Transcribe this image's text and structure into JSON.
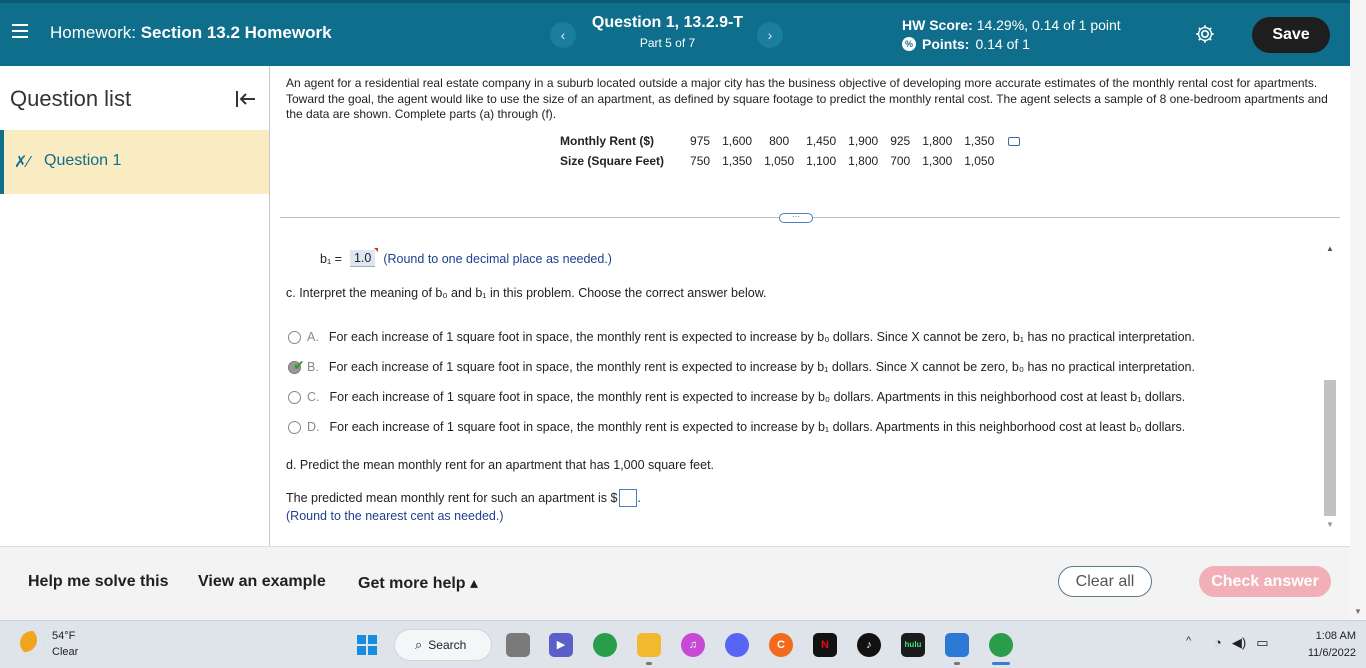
{
  "header": {
    "hw_prefix": "Homework:",
    "hw_title": "Section 13.2 Homework",
    "prev": "‹",
    "next": "›",
    "question": "Question 1, 13.2.9-T",
    "part": "Part 5 of 7",
    "score_label": "HW Score:",
    "score_value": "14.29%, 0.14 of 1 point",
    "points_label": "Points:",
    "points_value": "0.14 of 1",
    "save": "Save"
  },
  "sidebar": {
    "title": "Question list",
    "items": [
      {
        "label": "Question 1",
        "status_icon": "partial-icon"
      }
    ]
  },
  "problem": {
    "intro": "An agent for a residential real estate company in a suburb located outside a major city has the business objective of developing more accurate estimates of the monthly rental cost for apartments. Toward the goal, the agent would like to use the size of an apartment, as defined by square footage to predict the monthly rental cost. The agent selects a sample of 8 one-bedroom apartments and the data are shown. Complete parts (a) through (f).",
    "rent_label": "Monthly Rent ($)",
    "size_label": "Size (Square Feet)",
    "rent": [
      "975",
      "1,600",
      "800",
      "1,450",
      "1,900",
      "925",
      "1,800",
      "1,350"
    ],
    "size": [
      "750",
      "1,350",
      "1,050",
      "1,100",
      "1,800",
      "700",
      "1,300",
      "1,050"
    ],
    "more": "⋯"
  },
  "answer": {
    "b1_label": "b₁ =",
    "b1_value": "1.0",
    "b1_note": "(Round to one decimal place as needed.)",
    "part_c": "c. Interpret the meaning of b₀ and b₁ in this problem. Choose the correct answer below.",
    "options": [
      {
        "letter": "A.",
        "text": "For each increase of 1 square foot in space, the monthly rent is expected to increase by b₀ dollars. Since X cannot be zero, b₁ has no practical interpretation."
      },
      {
        "letter": "B.",
        "text": "For each increase of 1 square foot in space, the monthly rent is expected to increase by b₁ dollars. Since X cannot be zero, b₀ has no practical interpretation."
      },
      {
        "letter": "C.",
        "text": "For each increase of 1 square foot in space, the monthly rent is expected to increase by b₀ dollars. Apartments in this neighborhood cost at least b₁ dollars."
      },
      {
        "letter": "D.",
        "text": "For each increase of 1 square foot in space, the monthly rent is expected to increase by b₁ dollars. Apartments in this neighborhood cost at least b₀ dollars."
      }
    ],
    "selected": "B.",
    "part_d": "d. Predict the mean monthly rent for an apartment that has 1,000 square feet.",
    "pred_text": "The predicted mean monthly rent for such an apartment is $",
    "pred_value": "",
    "pred_note": "(Round to the nearest cent as needed.)"
  },
  "footer": {
    "help": "Help me solve this",
    "example": "View an example",
    "more_help": "Get more help ▴",
    "clear": "Clear all",
    "check": "Check answer"
  },
  "taskbar": {
    "temp": "54°F",
    "cond": "Clear",
    "search": "Search",
    "time": "1:08 AM",
    "date": "11/6/2022"
  },
  "colors": {
    "header_bg": "#0e6e8c",
    "selected_item_bg": "#f9ecc2",
    "check_button": "#f1b0b8"
  }
}
